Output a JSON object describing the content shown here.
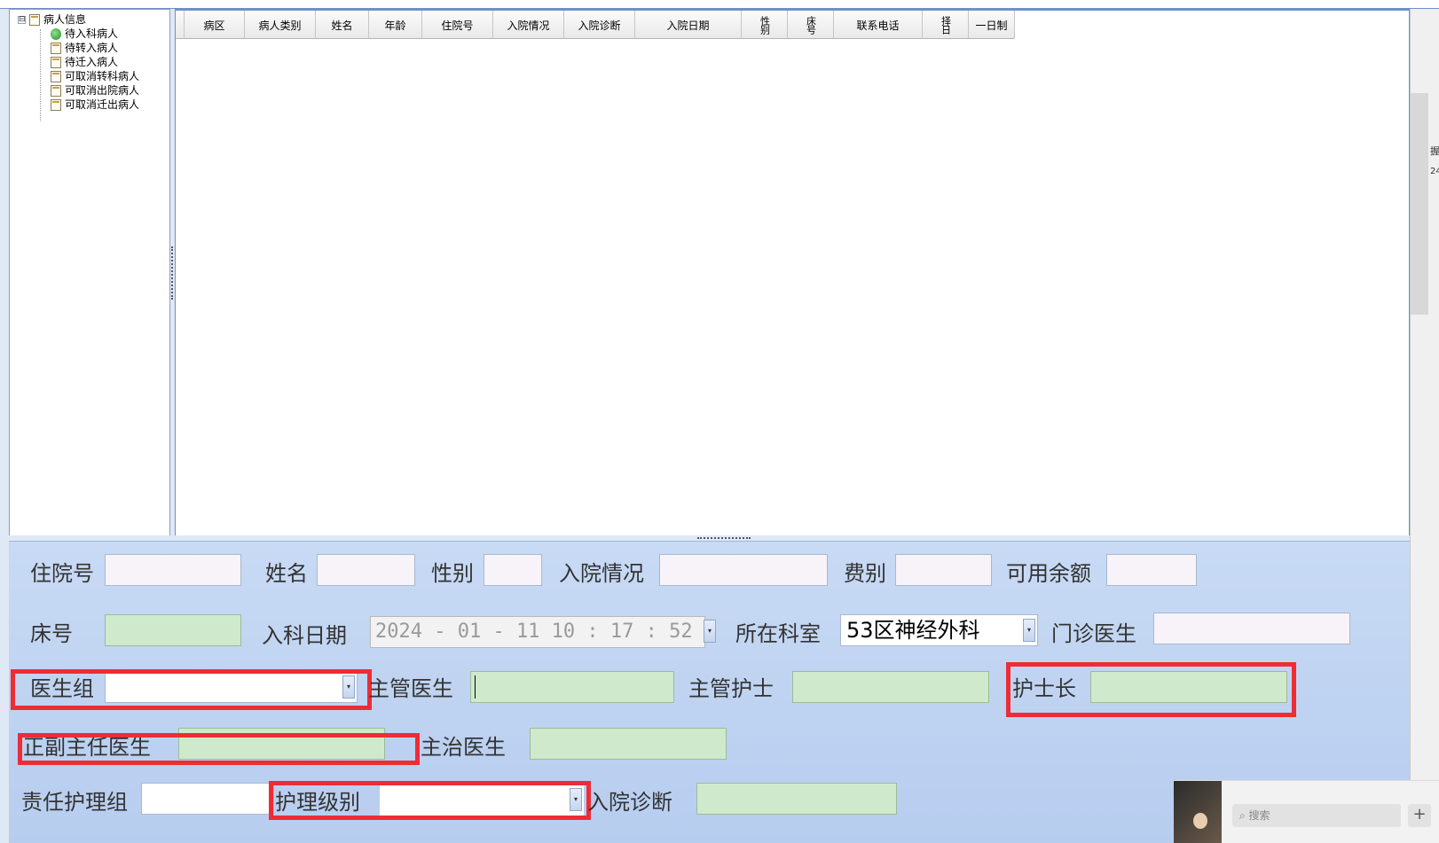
{
  "tree": {
    "root_label": "病人信息",
    "toggle": "⊟",
    "items": [
      {
        "label": "待入科病人",
        "icon": "check-icon"
      },
      {
        "label": "待转入病人",
        "icon": "note-icon"
      },
      {
        "label": "待迁入病人",
        "icon": "note-icon"
      },
      {
        "label": "可取消转科病人",
        "icon": "note-icon"
      },
      {
        "label": "可取消出院病人",
        "icon": "note-icon"
      },
      {
        "label": "可取消迁出病人",
        "icon": "note-icon"
      }
    ]
  },
  "grid": {
    "columns": [
      "病区",
      "病人类别",
      "姓名",
      "年龄",
      "住院号",
      "入院情况",
      "入院诊断",
      "入院日期",
      "性别",
      "床号",
      "联系电话",
      "择日",
      "一日制"
    ]
  },
  "form": {
    "zyh_label": "住院号",
    "name_label": "姓名",
    "sex_label": "性别",
    "admit_status_label": "入院情况",
    "fee_label": "费别",
    "balance_label": "可用余额",
    "bed_label": "床号",
    "dept_date_label": "入科日期",
    "dept_date_value": "2024 - 01 - 11   10 : 17 : 52",
    "dept_label": "所在科室",
    "dept_value": "53区神经外科",
    "outpatient_doctor_label": "门诊医生",
    "doctor_group_label": "医生组",
    "attending_doctor_label": "主管医生",
    "attending_nurse_label": "主管护士",
    "head_nurse_label": "护士长",
    "chief_doctor_label": "正副主任医生",
    "treating_doctor_label": "主治医生",
    "nursing_group_label": "责任护理组",
    "nursing_level_label": "护理级别",
    "admit_diagnosis_label": "入院诊断"
  },
  "chat": {
    "search_placeholder": "搜索",
    "plus": "+"
  },
  "edge": {
    "t1": "握",
    "t2": "24"
  },
  "colors": {
    "highlight": "#ee2c35",
    "green_field": "#cfe9cc",
    "form_bg": "#c8daf4"
  }
}
